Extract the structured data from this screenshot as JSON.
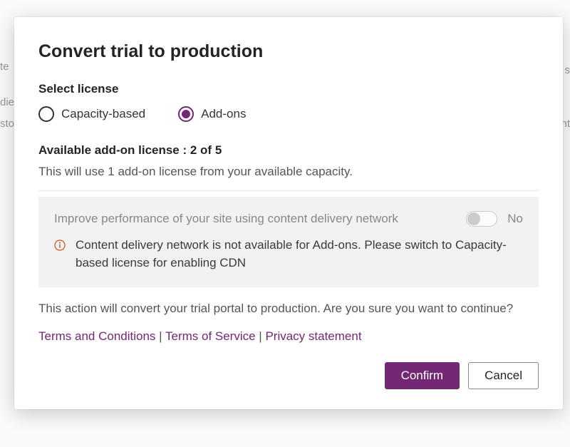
{
  "modal": {
    "title": "Convert trial to production",
    "select_license_label": "Select license",
    "radio": {
      "capacity_label": "Capacity-based",
      "addons_label": "Add-ons",
      "selected": "addons"
    },
    "available_label": "Available add-on license : 2 of 5",
    "helper": "This will use 1 add-on license from your available capacity.",
    "cdn": {
      "title": "Improve performance of your site using content delivery network",
      "toggle_state": "off",
      "toggle_label": "No",
      "message": "Content delivery network is not available for Add-ons. Please switch to Capacity-based license for enabling CDN"
    },
    "confirm_text": "This action will convert your trial portal to production. Are you sure you want to continue?",
    "links": {
      "terms_conditions": "Terms and Conditions",
      "terms_service": "Terms of Service",
      "privacy": "Privacy statement",
      "separator": " | "
    },
    "buttons": {
      "confirm": "Confirm",
      "cancel": "Cancel"
    }
  }
}
